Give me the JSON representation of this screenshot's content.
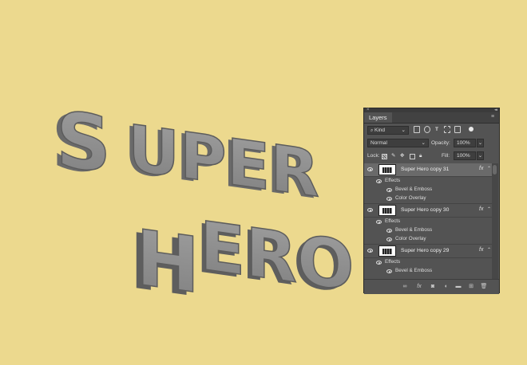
{
  "panel": {
    "tab_label": "Layers",
    "filter_label": "Kind",
    "blend_mode": "Normal",
    "opacity_label": "Opacity:",
    "opacity_value": "100%",
    "lock_label": "Lock:",
    "fill_label": "Fill:",
    "fill_value": "100%"
  },
  "layers": [
    {
      "name": "Super Hero copy 31",
      "effects_label": "Effects",
      "effects": [
        "Bevel & Emboss",
        "Color Overlay"
      ]
    },
    {
      "name": "Super Hero copy 30",
      "effects_label": "Effects",
      "effects": [
        "Bevel & Emboss",
        "Color Overlay"
      ]
    },
    {
      "name": "Super Hero copy 29",
      "effects_label": "Effects",
      "effects": [
        "Bevel & Emboss"
      ]
    }
  ],
  "fx_label": "fx",
  "colors": {
    "background": "#ecd98e",
    "panel": "#535353",
    "letters": "#8d8d8d"
  }
}
